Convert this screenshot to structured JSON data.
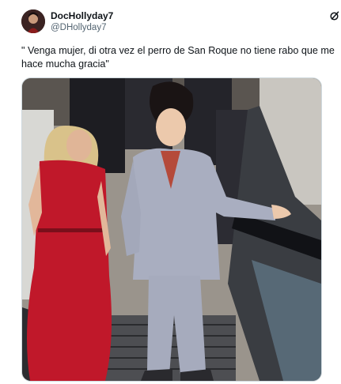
{
  "tweet": {
    "display_name": "DocHollyday7",
    "handle": "@DHollyday7",
    "text": "\" Venga mujer, di otra vez el perro de San Roque no tiene rabo que me hace mucha gracia\"",
    "header_icon": "grok-icon",
    "media": {
      "kind": "photo",
      "subject": "two women riding an escalator"
    }
  },
  "colors": {
    "text_primary": "#0f1419",
    "text_secondary": "#536471",
    "border": "#cfd9de",
    "dress_red": "#c0182a",
    "suit_gray": "#a9aec0"
  }
}
